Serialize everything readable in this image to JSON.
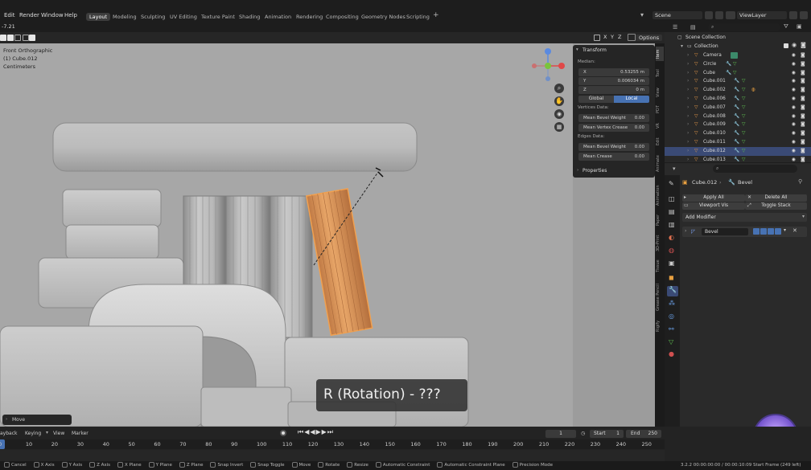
{
  "menu": [
    "Edit",
    "Render",
    "Window",
    "Help"
  ],
  "workspaces": [
    "Layout",
    "Modeling",
    "Sculpting",
    "UV Editing",
    "Texture Paint",
    "Shading",
    "Animation",
    "Rendering",
    "Compositing",
    "Geometry Nodes",
    "Scripting"
  ],
  "workspace_add": "+",
  "scene_name": "Scene",
  "view_layer": "ViewLayer",
  "coord_readout": "-7.21",
  "viewport_header": {
    "axes": [
      "X",
      "Y",
      "Z"
    ],
    "options_label": "Options"
  },
  "viewport_info": {
    "view": "Front Orthographic",
    "object": "(1) Cube.012",
    "units": "Centimeters"
  },
  "operator_panel": "Move",
  "overlay_text": "R (Rotation) - ???",
  "transform_panel": {
    "title": "Transform",
    "median_label": "Median:",
    "x_label": "X",
    "x_value": "0.53255 m",
    "y_label": "Y",
    "y_value": "0.006034 m",
    "z_label": "Z",
    "z_value": "0 m",
    "global_label": "Global",
    "local_label": "Local",
    "vertices_label": "Vertices Data:",
    "mean_bevel_weight_label": "Mean Bevel Weight",
    "mean_bevel_weight_value": "0.00",
    "mean_vertex_crease_label": "Mean Vertex Crease",
    "mean_vertex_crease_value": "0.00",
    "edges_label": "Edges Data:",
    "edge_bevel_weight_label": "Mean Bevel Weight",
    "edge_bevel_weight_value": "0.00",
    "mean_crease_label": "Mean Crease",
    "mean_crease_value": "0.00",
    "properties_label": "Properties"
  },
  "n_tabs": [
    "Item",
    "Tool",
    "View",
    "PDT",
    "VR",
    "Edit",
    "Animate"
  ],
  "props_tabs_vertical": [
    "Animation",
    "Paper",
    "3D-Print",
    "Tissue",
    "Grease Pencil",
    "Rigify"
  ],
  "outliner": {
    "scene_collection": "Scene Collection",
    "collection": "Collection",
    "items": [
      "Camera",
      "Circle",
      "Cube",
      "Cube.001",
      "Cube.002",
      "Cube.006",
      "Cube.007",
      "Cube.008",
      "Cube.009",
      "Cube.010",
      "Cube.011",
      "Cube.012",
      "Cube.013"
    ],
    "selected_index": 11
  },
  "properties": {
    "object_name": "Cube.012",
    "modifier_path": "Bevel",
    "apply_all": "Apply All",
    "delete_all": "Delete All",
    "viewport_vis": "Viewport Vis",
    "toggle_stack": "Toggle Stack",
    "add_modifier": "Add Modifier",
    "modifier_name": "Bevel"
  },
  "timeline": {
    "menu": [
      "ayback",
      "Keying",
      "View",
      "Marker"
    ],
    "current_frame": "1",
    "start_label": "Start",
    "start_value": "1",
    "end_label": "End",
    "end_value": "250",
    "ticks": [
      "0",
      "10",
      "20",
      "30",
      "40",
      "50",
      "60",
      "70",
      "80",
      "90",
      "100",
      "110",
      "120",
      "130",
      "140",
      "150",
      "160",
      "170",
      "180",
      "190",
      "200",
      "210",
      "220",
      "230",
      "240",
      "250"
    ]
  },
  "statusbar": {
    "items": [
      "Cancel",
      "X Axis",
      "Y Axis",
      "Z Axis",
      "X Plane",
      "Y Plane",
      "Z Plane",
      "Snap Invert",
      "Snap Toggle",
      "Move",
      "Rotate",
      "Resize",
      "Automatic Constraint",
      "Automatic Constraint Plane",
      "Precision Mode"
    ],
    "right": "3.2.2 00:00:00:00 / 00:00:10:09 Start Frame (249 left)"
  },
  "colors": {
    "accent": "#4772b3",
    "selected_orange": "#e8a060",
    "viewport_bg": "#a6a6a6",
    "panel": "#252525"
  }
}
